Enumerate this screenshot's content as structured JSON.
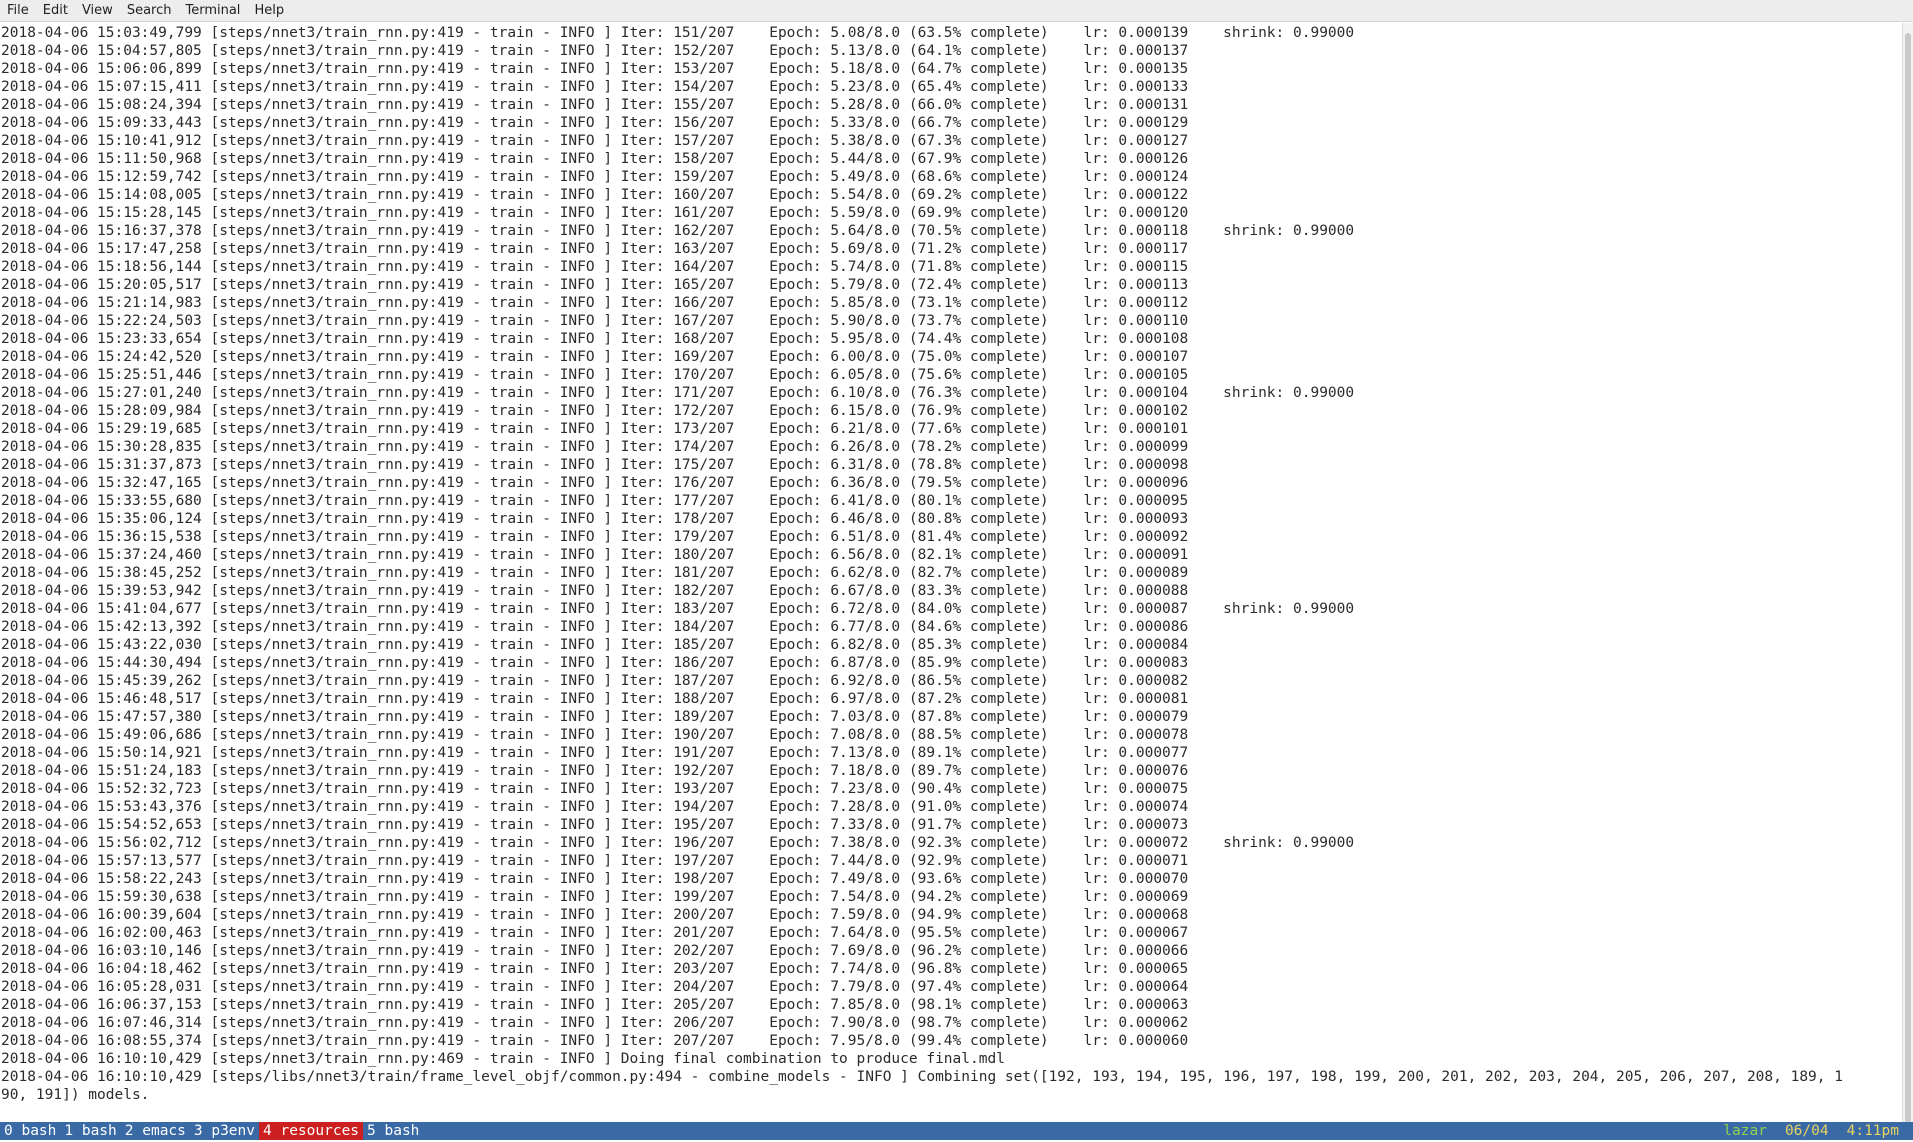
{
  "menubar": {
    "items": [
      "File",
      "Edit",
      "View",
      "Search",
      "Terminal",
      "Help"
    ]
  },
  "terminal": {
    "lines": [
      "2018-04-06 15:03:49,799 [steps/nnet3/train_rnn.py:419 - train - INFO ] Iter: 151/207    Epoch: 5.08/8.0 (63.5% complete)    lr: 0.000139    shrink: 0.99000",
      "2018-04-06 15:04:57,805 [steps/nnet3/train_rnn.py:419 - train - INFO ] Iter: 152/207    Epoch: 5.13/8.0 (64.1% complete)    lr: 0.000137",
      "2018-04-06 15:06:06,899 [steps/nnet3/train_rnn.py:419 - train - INFO ] Iter: 153/207    Epoch: 5.18/8.0 (64.7% complete)    lr: 0.000135",
      "2018-04-06 15:07:15,411 [steps/nnet3/train_rnn.py:419 - train - INFO ] Iter: 154/207    Epoch: 5.23/8.0 (65.4% complete)    lr: 0.000133",
      "2018-04-06 15:08:24,394 [steps/nnet3/train_rnn.py:419 - train - INFO ] Iter: 155/207    Epoch: 5.28/8.0 (66.0% complete)    lr: 0.000131",
      "2018-04-06 15:09:33,443 [steps/nnet3/train_rnn.py:419 - train - INFO ] Iter: 156/207    Epoch: 5.33/8.0 (66.7% complete)    lr: 0.000129",
      "2018-04-06 15:10:41,912 [steps/nnet3/train_rnn.py:419 - train - INFO ] Iter: 157/207    Epoch: 5.38/8.0 (67.3% complete)    lr: 0.000127",
      "2018-04-06 15:11:50,968 [steps/nnet3/train_rnn.py:419 - train - INFO ] Iter: 158/207    Epoch: 5.44/8.0 (67.9% complete)    lr: 0.000126",
      "2018-04-06 15:12:59,742 [steps/nnet3/train_rnn.py:419 - train - INFO ] Iter: 159/207    Epoch: 5.49/8.0 (68.6% complete)    lr: 0.000124",
      "2018-04-06 15:14:08,005 [steps/nnet3/train_rnn.py:419 - train - INFO ] Iter: 160/207    Epoch: 5.54/8.0 (69.2% complete)    lr: 0.000122",
      "2018-04-06 15:15:28,145 [steps/nnet3/train_rnn.py:419 - train - INFO ] Iter: 161/207    Epoch: 5.59/8.0 (69.9% complete)    lr: 0.000120",
      "2018-04-06 15:16:37,378 [steps/nnet3/train_rnn.py:419 - train - INFO ] Iter: 162/207    Epoch: 5.64/8.0 (70.5% complete)    lr: 0.000118    shrink: 0.99000",
      "2018-04-06 15:17:47,258 [steps/nnet3/train_rnn.py:419 - train - INFO ] Iter: 163/207    Epoch: 5.69/8.0 (71.2% complete)    lr: 0.000117",
      "2018-04-06 15:18:56,144 [steps/nnet3/train_rnn.py:419 - train - INFO ] Iter: 164/207    Epoch: 5.74/8.0 (71.8% complete)    lr: 0.000115",
      "2018-04-06 15:20:05,517 [steps/nnet3/train_rnn.py:419 - train - INFO ] Iter: 165/207    Epoch: 5.79/8.0 (72.4% complete)    lr: 0.000113",
      "2018-04-06 15:21:14,983 [steps/nnet3/train_rnn.py:419 - train - INFO ] Iter: 166/207    Epoch: 5.85/8.0 (73.1% complete)    lr: 0.000112",
      "2018-04-06 15:22:24,503 [steps/nnet3/train_rnn.py:419 - train - INFO ] Iter: 167/207    Epoch: 5.90/8.0 (73.7% complete)    lr: 0.000110",
      "2018-04-06 15:23:33,654 [steps/nnet3/train_rnn.py:419 - train - INFO ] Iter: 168/207    Epoch: 5.95/8.0 (74.4% complete)    lr: 0.000108",
      "2018-04-06 15:24:42,520 [steps/nnet3/train_rnn.py:419 - train - INFO ] Iter: 169/207    Epoch: 6.00/8.0 (75.0% complete)    lr: 0.000107",
      "2018-04-06 15:25:51,446 [steps/nnet3/train_rnn.py:419 - train - INFO ] Iter: 170/207    Epoch: 6.05/8.0 (75.6% complete)    lr: 0.000105",
      "2018-04-06 15:27:01,240 [steps/nnet3/train_rnn.py:419 - train - INFO ] Iter: 171/207    Epoch: 6.10/8.0 (76.3% complete)    lr: 0.000104    shrink: 0.99000",
      "2018-04-06 15:28:09,984 [steps/nnet3/train_rnn.py:419 - train - INFO ] Iter: 172/207    Epoch: 6.15/8.0 (76.9% complete)    lr: 0.000102",
      "2018-04-06 15:29:19,685 [steps/nnet3/train_rnn.py:419 - train - INFO ] Iter: 173/207    Epoch: 6.21/8.0 (77.6% complete)    lr: 0.000101",
      "2018-04-06 15:30:28,835 [steps/nnet3/train_rnn.py:419 - train - INFO ] Iter: 174/207    Epoch: 6.26/8.0 (78.2% complete)    lr: 0.000099",
      "2018-04-06 15:31:37,873 [steps/nnet3/train_rnn.py:419 - train - INFO ] Iter: 175/207    Epoch: 6.31/8.0 (78.8% complete)    lr: 0.000098",
      "2018-04-06 15:32:47,165 [steps/nnet3/train_rnn.py:419 - train - INFO ] Iter: 176/207    Epoch: 6.36/8.0 (79.5% complete)    lr: 0.000096",
      "2018-04-06 15:33:55,680 [steps/nnet3/train_rnn.py:419 - train - INFO ] Iter: 177/207    Epoch: 6.41/8.0 (80.1% complete)    lr: 0.000095",
      "2018-04-06 15:35:06,124 [steps/nnet3/train_rnn.py:419 - train - INFO ] Iter: 178/207    Epoch: 6.46/8.0 (80.8% complete)    lr: 0.000093",
      "2018-04-06 15:36:15,538 [steps/nnet3/train_rnn.py:419 - train - INFO ] Iter: 179/207    Epoch: 6.51/8.0 (81.4% complete)    lr: 0.000092",
      "2018-04-06 15:37:24,460 [steps/nnet3/train_rnn.py:419 - train - INFO ] Iter: 180/207    Epoch: 6.56/8.0 (82.1% complete)    lr: 0.000091",
      "2018-04-06 15:38:45,252 [steps/nnet3/train_rnn.py:419 - train - INFO ] Iter: 181/207    Epoch: 6.62/8.0 (82.7% complete)    lr: 0.000089",
      "2018-04-06 15:39:53,942 [steps/nnet3/train_rnn.py:419 - train - INFO ] Iter: 182/207    Epoch: 6.67/8.0 (83.3% complete)    lr: 0.000088",
      "2018-04-06 15:41:04,677 [steps/nnet3/train_rnn.py:419 - train - INFO ] Iter: 183/207    Epoch: 6.72/8.0 (84.0% complete)    lr: 0.000087    shrink: 0.99000",
      "2018-04-06 15:42:13,392 [steps/nnet3/train_rnn.py:419 - train - INFO ] Iter: 184/207    Epoch: 6.77/8.0 (84.6% complete)    lr: 0.000086",
      "2018-04-06 15:43:22,030 [steps/nnet3/train_rnn.py:419 - train - INFO ] Iter: 185/207    Epoch: 6.82/8.0 (85.3% complete)    lr: 0.000084",
      "2018-04-06 15:44:30,494 [steps/nnet3/train_rnn.py:419 - train - INFO ] Iter: 186/207    Epoch: 6.87/8.0 (85.9% complete)    lr: 0.000083",
      "2018-04-06 15:45:39,262 [steps/nnet3/train_rnn.py:419 - train - INFO ] Iter: 187/207    Epoch: 6.92/8.0 (86.5% complete)    lr: 0.000082",
      "2018-04-06 15:46:48,517 [steps/nnet3/train_rnn.py:419 - train - INFO ] Iter: 188/207    Epoch: 6.97/8.0 (87.2% complete)    lr: 0.000081",
      "2018-04-06 15:47:57,380 [steps/nnet3/train_rnn.py:419 - train - INFO ] Iter: 189/207    Epoch: 7.03/8.0 (87.8% complete)    lr: 0.000079",
      "2018-04-06 15:49:06,686 [steps/nnet3/train_rnn.py:419 - train - INFO ] Iter: 190/207    Epoch: 7.08/8.0 (88.5% complete)    lr: 0.000078",
      "2018-04-06 15:50:14,921 [steps/nnet3/train_rnn.py:419 - train - INFO ] Iter: 191/207    Epoch: 7.13/8.0 (89.1% complete)    lr: 0.000077",
      "2018-04-06 15:51:24,183 [steps/nnet3/train_rnn.py:419 - train - INFO ] Iter: 192/207    Epoch: 7.18/8.0 (89.7% complete)    lr: 0.000076",
      "2018-04-06 15:52:32,723 [steps/nnet3/train_rnn.py:419 - train - INFO ] Iter: 193/207    Epoch: 7.23/8.0 (90.4% complete)    lr: 0.000075",
      "2018-04-06 15:53:43,376 [steps/nnet3/train_rnn.py:419 - train - INFO ] Iter: 194/207    Epoch: 7.28/8.0 (91.0% complete)    lr: 0.000074",
      "2018-04-06 15:54:52,653 [steps/nnet3/train_rnn.py:419 - train - INFO ] Iter: 195/207    Epoch: 7.33/8.0 (91.7% complete)    lr: 0.000073",
      "2018-04-06 15:56:02,712 [steps/nnet3/train_rnn.py:419 - train - INFO ] Iter: 196/207    Epoch: 7.38/8.0 (92.3% complete)    lr: 0.000072    shrink: 0.99000",
      "2018-04-06 15:57:13,577 [steps/nnet3/train_rnn.py:419 - train - INFO ] Iter: 197/207    Epoch: 7.44/8.0 (92.9% complete)    lr: 0.000071",
      "2018-04-06 15:58:22,243 [steps/nnet3/train_rnn.py:419 - train - INFO ] Iter: 198/207    Epoch: 7.49/8.0 (93.6% complete)    lr: 0.000070",
      "2018-04-06 15:59:30,638 [steps/nnet3/train_rnn.py:419 - train - INFO ] Iter: 199/207    Epoch: 7.54/8.0 (94.2% complete)    lr: 0.000069",
      "2018-04-06 16:00:39,604 [steps/nnet3/train_rnn.py:419 - train - INFO ] Iter: 200/207    Epoch: 7.59/8.0 (94.9% complete)    lr: 0.000068",
      "2018-04-06 16:02:00,463 [steps/nnet3/train_rnn.py:419 - train - INFO ] Iter: 201/207    Epoch: 7.64/8.0 (95.5% complete)    lr: 0.000067",
      "2018-04-06 16:03:10,146 [steps/nnet3/train_rnn.py:419 - train - INFO ] Iter: 202/207    Epoch: 7.69/8.0 (96.2% complete)    lr: 0.000066",
      "2018-04-06 16:04:18,462 [steps/nnet3/train_rnn.py:419 - train - INFO ] Iter: 203/207    Epoch: 7.74/8.0 (96.8% complete)    lr: 0.000065",
      "2018-04-06 16:05:28,031 [steps/nnet3/train_rnn.py:419 - train - INFO ] Iter: 204/207    Epoch: 7.79/8.0 (97.4% complete)    lr: 0.000064",
      "2018-04-06 16:06:37,153 [steps/nnet3/train_rnn.py:419 - train - INFO ] Iter: 205/207    Epoch: 7.85/8.0 (98.1% complete)    lr: 0.000063",
      "2018-04-06 16:07:46,314 [steps/nnet3/train_rnn.py:419 - train - INFO ] Iter: 206/207    Epoch: 7.90/8.0 (98.7% complete)    lr: 0.000062",
      "2018-04-06 16:08:55,374 [steps/nnet3/train_rnn.py:419 - train - INFO ] Iter: 207/207    Epoch: 7.95/8.0 (99.4% complete)    lr: 0.000060",
      "2018-04-06 16:10:10,429 [steps/nnet3/train_rnn.py:469 - train - INFO ] Doing final combination to produce final.mdl",
      "2018-04-06 16:10:10,429 [steps/libs/nnet3/train/frame_level_objf/common.py:494 - combine_models - INFO ] Combining set([192, 193, 194, 195, 196, 197, 198, 199, 200, 201, 202, 203, 204, 205, 206, 207, 208, 189, 1",
      "90, 191]) models."
    ]
  },
  "statusbar": {
    "windows": [
      {
        "label": "0 bash",
        "active": false
      },
      {
        "label": "1 bash",
        "active": false
      },
      {
        "label": "2 emacs",
        "active": false
      },
      {
        "label": "3 p3env",
        "active": false
      },
      {
        "label": "4 resources",
        "active": true
      },
      {
        "label": "5 bash",
        "active": false
      }
    ],
    "user": "lazar",
    "date": "06/04",
    "time": "4:11pm"
  },
  "colors": {
    "statusbar_bg": "#3a6aa6",
    "active_window_bg": "#cc1f1f",
    "user_color": "#8fd14f",
    "clock_color": "#e8d35f"
  }
}
